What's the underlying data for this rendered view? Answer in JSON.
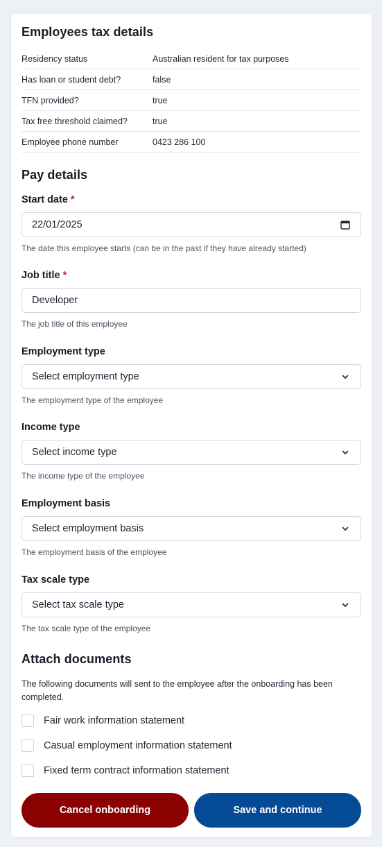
{
  "tax_details": {
    "title": "Employees tax details",
    "rows": [
      {
        "key": "Residency status",
        "value": "Australian resident for tax purposes"
      },
      {
        "key": "Has loan or student debt?",
        "value": "false"
      },
      {
        "key": "TFN provided?",
        "value": "true"
      },
      {
        "key": "Tax free threshold claimed?",
        "value": "true"
      },
      {
        "key": "Employee phone number",
        "value": "0423 286 100"
      }
    ]
  },
  "pay_details": {
    "title": "Pay details",
    "start_date": {
      "label": "Start date",
      "required_mark": "*",
      "value": "22/01/2025",
      "help": "The date this employee starts (can be in the past if they have already started)",
      "icon": "calendar-icon"
    },
    "job_title": {
      "label": "Job title",
      "required_mark": "*",
      "value": "Developer",
      "help": "The job title of this employee"
    },
    "employment_type": {
      "label": "Employment type",
      "selected": "Select employment type",
      "help": "The employment type of the employee",
      "icon": "chevron-down-icon"
    },
    "income_type": {
      "label": "Income type",
      "selected": "Select income type",
      "help": "The income type of the employee",
      "icon": "chevron-down-icon"
    },
    "employment_basis": {
      "label": "Employment basis",
      "selected": "Select employment basis",
      "help": "The employment basis of the employee",
      "icon": "chevron-down-icon"
    },
    "tax_scale_type": {
      "label": "Tax scale type",
      "selected": "Select tax scale type",
      "help": "The tax scale type of the employee",
      "icon": "chevron-down-icon"
    }
  },
  "attach_documents": {
    "title": "Attach documents",
    "description": "The following documents will sent to the employee after the onboarding has been completed.",
    "documents": [
      {
        "label": "Fair work information statement",
        "checked": false
      },
      {
        "label": "Casual employment information statement",
        "checked": false
      },
      {
        "label": "Fixed term contract information statement",
        "checked": false
      }
    ]
  },
  "actions": {
    "cancel_label": "Cancel onboarding",
    "save_label": "Save and continue"
  },
  "colors": {
    "background": "#edf1f5",
    "cancel_button": "#8b0000",
    "save_button": "#044a94",
    "required": "#c81e1e"
  }
}
